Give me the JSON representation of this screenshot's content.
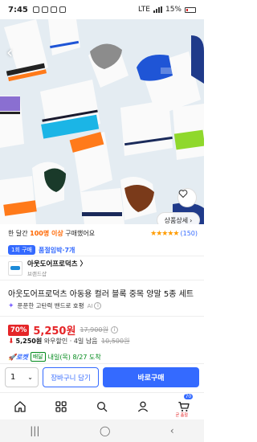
{
  "status_bar": {
    "time": "7:45",
    "network": "LTE",
    "battery": "15%"
  },
  "product_image": {
    "dots_count": 9,
    "active_dot": 4,
    "detail_button": "상품상세"
  },
  "buyers": {
    "prefix": "한 달간",
    "count": "100명 이상",
    "suffix": "구매했어요"
  },
  "rating": {
    "stars": "★★★★★",
    "count": "(150)"
  },
  "rank": {
    "badge": "1회 구매",
    "category": "품절임박·7개"
  },
  "brand": {
    "name": "아웃도어프로덕츠 〉",
    "sub": "브랜드샵"
  },
  "title": "아웃도어프로덕츠 아동용 컬러 블록 중목 양말 5종 세트",
  "ai_summary": {
    "text": "푼푼한 고탄력 밴드로 호평",
    "tag": "AI"
  },
  "price": {
    "discount": "70%",
    "sale": "5,250원",
    "original": "17,900원"
  },
  "unit_price": {
    "value": "5,250원",
    "text": "와우할인 · 4일 남음",
    "original": "10,500원"
  },
  "delivery": {
    "rocket": "로켓",
    "tag": "배달",
    "text": "내일(목) 8/27 도착"
  },
  "purchase_bar": {
    "quantity": "1",
    "cart_label": "장바구니 담기",
    "buy_label": "바로구매"
  },
  "bottom_nav": {
    "cart_count": "70",
    "cart_sub": "곧 품절"
  },
  "colors": {
    "accent": "#346aff",
    "price_red": "#e52528",
    "star": "#ff9c00",
    "green": "#00891a"
  }
}
